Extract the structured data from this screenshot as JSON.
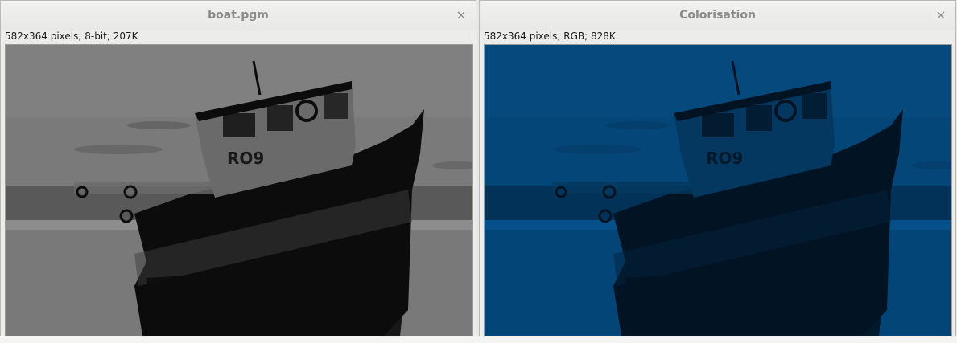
{
  "windows": [
    {
      "title": "boat.pgm",
      "info": "582x364 pixels; 8-bit; 207K",
      "close_glyph": "×",
      "tone": "grayscale"
    },
    {
      "title": "Colorisation",
      "info": "582x364 pixels; RGB; 828K",
      "close_glyph": "×",
      "tone": "blue"
    }
  ],
  "boat_hull_label": "RO9",
  "palette": {
    "grayscale": {
      "sky": "#7a7a7a",
      "sky_light": "#8c8c8c",
      "water": "#8d8d8d",
      "dark": "#0c0c0c",
      "mid": "#3e3e3e",
      "cabin": "#6a6a6a",
      "cloud": "#5c5c5c"
    },
    "blue": {
      "sky": "#054678",
      "sky_light": "#0a4f85",
      "water": "#05508a",
      "dark": "#021424",
      "mid": "#02223e",
      "cabin": "#043860",
      "cloud": "#033a66"
    }
  }
}
